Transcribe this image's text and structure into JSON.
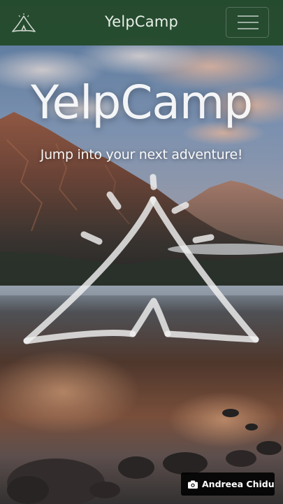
{
  "navbar": {
    "logo_icon": "tent-icon",
    "brand": "YelpCamp",
    "menu_icon": "hamburger-menu-icon",
    "background_color": "#224826"
  },
  "hero": {
    "title": "YelpCamp",
    "subtitle": "Jump into your next adventure!",
    "illustration_icon": "tent-sketch-icon"
  },
  "photo_credit": {
    "icon": "camera-icon",
    "name": "Andreea Chidu"
  }
}
